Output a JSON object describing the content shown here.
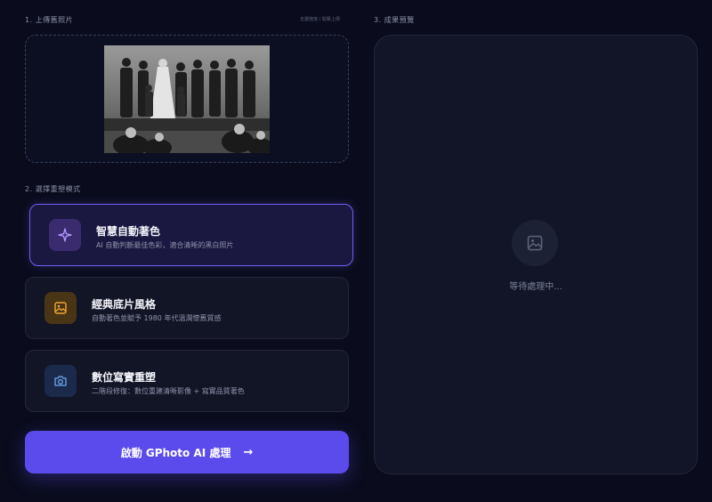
{
  "upload": {
    "section_title": "1. 上傳舊照片",
    "hint": "支援拖曳 / 點擊上傳"
  },
  "styles": {
    "section_title": "2. 選擇重塑模式",
    "items": [
      {
        "title": "智慧自動著色",
        "desc": "AI 自動判斷最佳色彩，適合清晰的黑白照片",
        "icon": "sparkle-icon",
        "active": true
      },
      {
        "title": "經典底片風格",
        "desc": "自動著色並賦予 1980 年代溫潤懷舊質感",
        "icon": "image-icon",
        "active": false
      },
      {
        "title": "數位寫實重塑",
        "desc": "二階段修復：數位重建清晰影像 + 寫實品質著色",
        "icon": "camera-icon",
        "active": false
      }
    ]
  },
  "start_button": {
    "label": "啟動 GPhoto AI 處理",
    "icon": "arrow-right-icon"
  },
  "preview": {
    "section_title": "3. 成果預覽",
    "placeholder_icon": "image-icon",
    "waiting_text": "等待處理中..."
  },
  "colors": {
    "background": "#0a0c1d",
    "accent": "#5b4bec",
    "active_border": "#6f5ff2",
    "card": "#121526"
  }
}
